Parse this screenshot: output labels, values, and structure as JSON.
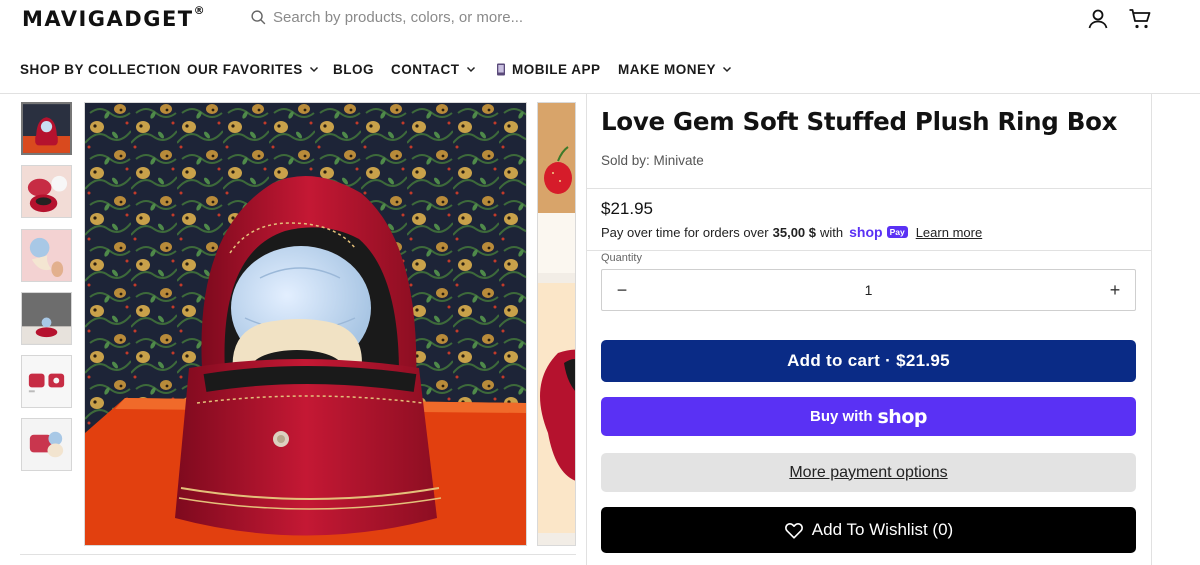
{
  "header": {
    "logo": "MAVIGADGET",
    "logo_mark": "®",
    "search_placeholder": "Search by products, colors, or more...",
    "account_icon": "account-icon",
    "cart_icon": "cart-icon"
  },
  "nav": {
    "items": [
      {
        "label": "SHOP BY COLLECTION"
      },
      {
        "label": "OUR FAVORITES"
      },
      {
        "label": "BLOG"
      },
      {
        "label": "CONTACT"
      },
      {
        "label": "MOBILE APP"
      },
      {
        "label": "MAKE MONEY"
      }
    ]
  },
  "product": {
    "title": "Love Gem Soft Stuffed Plush Ring Box",
    "seller": "Sold by: Minivate",
    "price": "$21.95",
    "installments_prefix": "Pay over time for orders over",
    "installments_threshold": "35,00 $",
    "installments_with": "with",
    "shop_word": "shop",
    "pay_badge": "Pay",
    "learn_more": "Learn more",
    "quantity_label": "Quantity",
    "quantity": "1",
    "minus": "−",
    "plus": "+"
  },
  "buttons": {
    "add_to_cart": "Add to cart · $21.95",
    "buy_with": "Buy with",
    "shop_logo": "shop",
    "more_payment": "More payment options",
    "wishlist": "Add To Wishlist (0)"
  },
  "colors": {
    "cart_button": "#0a2b86",
    "shop_button": "#5a31f4",
    "wishlist_button": "#000000",
    "plush_red": "#b5122e"
  }
}
